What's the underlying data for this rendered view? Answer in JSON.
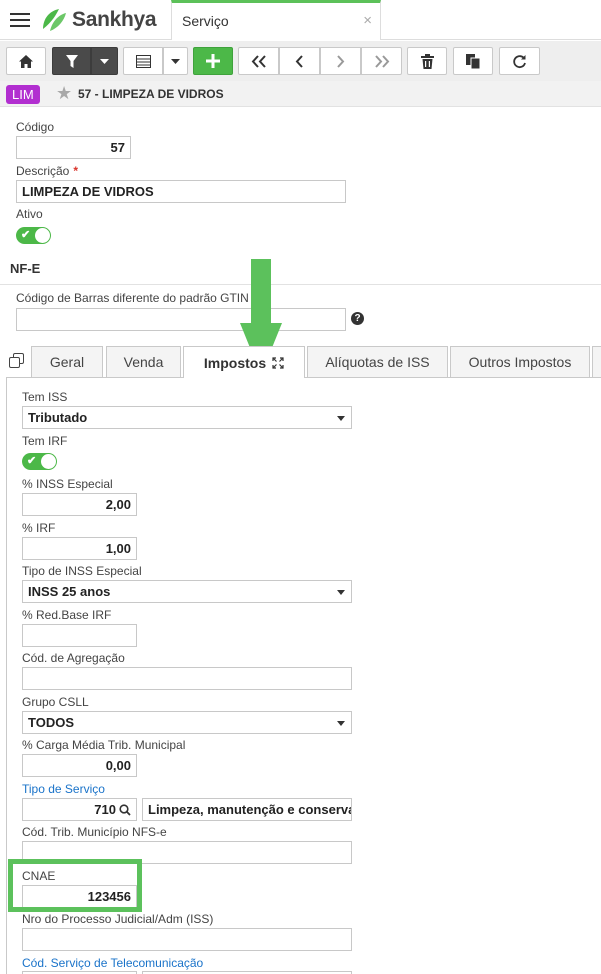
{
  "app": {
    "brand": "Sankhya",
    "active_tab": "Serviço",
    "close_glyph": "×"
  },
  "record": {
    "badge": "LIM",
    "title": "57 - LIMPEZA DE VIDROS"
  },
  "fields": {
    "codigo": {
      "label": "Código",
      "value": "57"
    },
    "descricao": {
      "label": "Descrição",
      "required_mark": "*",
      "value": "LIMPEZA DE VIDROS"
    },
    "ativo": {
      "label": "Ativo",
      "checked": true
    }
  },
  "nfe": {
    "title": "NF-E",
    "gtin_label": "Código de Barras diferente do padrão GTIN",
    "gtin_value": "",
    "help_glyph": "?"
  },
  "tabs": [
    {
      "label": "Geral"
    },
    {
      "label": "Venda"
    },
    {
      "label": "Impostos"
    },
    {
      "label": "Alíquotas de ISS"
    },
    {
      "label": "Outros Impostos"
    }
  ],
  "impostos": {
    "tem_iss": {
      "label": "Tem ISS",
      "value": "Tributado"
    },
    "tem_irf": {
      "label": "Tem IRF",
      "checked": true
    },
    "inss_especial": {
      "label": "% INSS Especial",
      "value": "2,00"
    },
    "irf": {
      "label": "% IRF",
      "value": "1,00"
    },
    "tipo_inss": {
      "label": "Tipo de INSS Especial",
      "value": "INSS 25 anos"
    },
    "red_base_irf": {
      "label": "% Red.Base IRF",
      "value": ""
    },
    "cod_agregacao": {
      "label": "Cód. de Agregação",
      "value": ""
    },
    "grupo_csll": {
      "label": "Grupo CSLL",
      "value": "TODOS"
    },
    "carga_media": {
      "label": "% Carga Média Trib. Municipal",
      "value": "0,00"
    },
    "tipo_servico": {
      "label": "Tipo de Serviço",
      "code": "710",
      "description": "Limpeza, manutenção e conservação"
    },
    "cod_trib_municipio": {
      "label": "Cód. Trib. Município NFS-e",
      "value": ""
    },
    "cnae": {
      "label": "CNAE",
      "value": "123456"
    },
    "nro_processo": {
      "label": "Nro do Processo Judicial/Adm (ISS)",
      "value": ""
    },
    "cod_telecom": {
      "label": "Cód. Serviço de Telecomunicação"
    }
  },
  "colors": {
    "accent_green": "#4cb848",
    "badge_purple": "#b22fd0",
    "link_blue": "#1a73c9",
    "annotation_green": "#5cc15c"
  },
  "icons": [
    "menu-icon",
    "home-icon",
    "filter-icon",
    "caret-down-icon",
    "grid-icon",
    "plus-icon",
    "first-icon",
    "previous-icon",
    "next-icon",
    "last-icon",
    "trash-icon",
    "copy-icon",
    "refresh-icon",
    "star-icon",
    "help-icon",
    "expand-icon",
    "search-icon"
  ]
}
